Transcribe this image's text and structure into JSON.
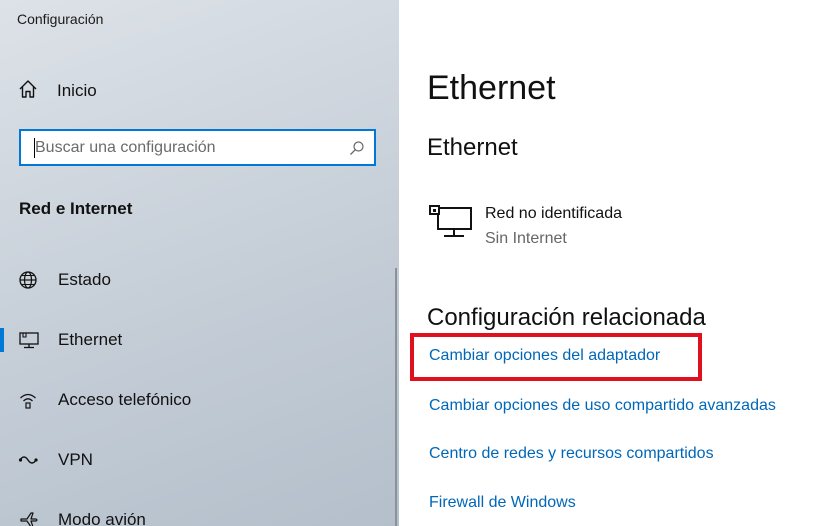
{
  "window": {
    "title": "Configuración"
  },
  "sidebar": {
    "home_label": "Inicio",
    "search": {
      "placeholder": "Buscar una configuración"
    },
    "section_title": "Red e Internet",
    "items": [
      {
        "label": "Estado",
        "icon": "globe-icon"
      },
      {
        "label": "Ethernet",
        "icon": "ethernet-monitor-icon",
        "selected": true
      },
      {
        "label": "Acceso telefónico",
        "icon": "dialup-icon"
      },
      {
        "label": "VPN",
        "icon": "vpn-icon"
      },
      {
        "label": "Modo avión",
        "icon": "airplane-icon"
      }
    ]
  },
  "main": {
    "title": "Ethernet",
    "subtitle": "Ethernet",
    "network": {
      "name": "Red no identificada",
      "status": "Sin Internet",
      "icon": "network-adapter-icon"
    },
    "related_title": "Configuración relacionada",
    "links": [
      "Cambiar opciones del adaptador",
      "Cambiar opciones de uso compartido avanzadas",
      "Centro de redes y recursos compartidos",
      "Firewall de Windows"
    ]
  },
  "colors": {
    "accent": "#0078d7",
    "link": "#0067b8",
    "highlight": "#e0101e"
  }
}
